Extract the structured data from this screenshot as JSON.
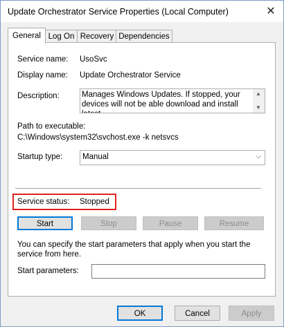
{
  "window": {
    "title": "Update Orchestrator Service Properties (Local Computer)",
    "close_glyph": "✕"
  },
  "tabs": [
    {
      "label": "General",
      "active": true
    },
    {
      "label": "Log On",
      "active": false
    },
    {
      "label": "Recovery",
      "active": false
    },
    {
      "label": "Dependencies",
      "active": false
    }
  ],
  "general": {
    "service_name_label": "Service name:",
    "service_name_value": "UsoSvc",
    "display_name_label": "Display name:",
    "display_name_value": "Update Orchestrator Service",
    "description_label": "Description:",
    "description_value": "Manages Windows Updates. If stopped, your devices will not be able download and install latest",
    "path_label": "Path to executable:",
    "path_value": "C:\\Windows\\system32\\svchost.exe -k netsvcs",
    "startup_type_label": "Startup type:",
    "startup_type_value": "Manual",
    "service_status_label": "Service status:",
    "service_status_value": "Stopped",
    "buttons": {
      "start": "Start",
      "stop": "Stop",
      "pause": "Pause",
      "resume": "Resume"
    },
    "hint": "You can specify the start parameters that apply when you start the service from here.",
    "start_params_label": "Start parameters:",
    "start_params_value": ""
  },
  "footer": {
    "ok": "OK",
    "cancel": "Cancel",
    "apply": "Apply"
  },
  "colors": {
    "highlight": "#e02020",
    "focus": "#0078d7"
  },
  "icons": {
    "close": "close-icon",
    "scroll_up": "scroll-up-arrow-icon",
    "scroll_down": "scroll-down-arrow-icon",
    "dropdown": "chevron-down-icon"
  }
}
